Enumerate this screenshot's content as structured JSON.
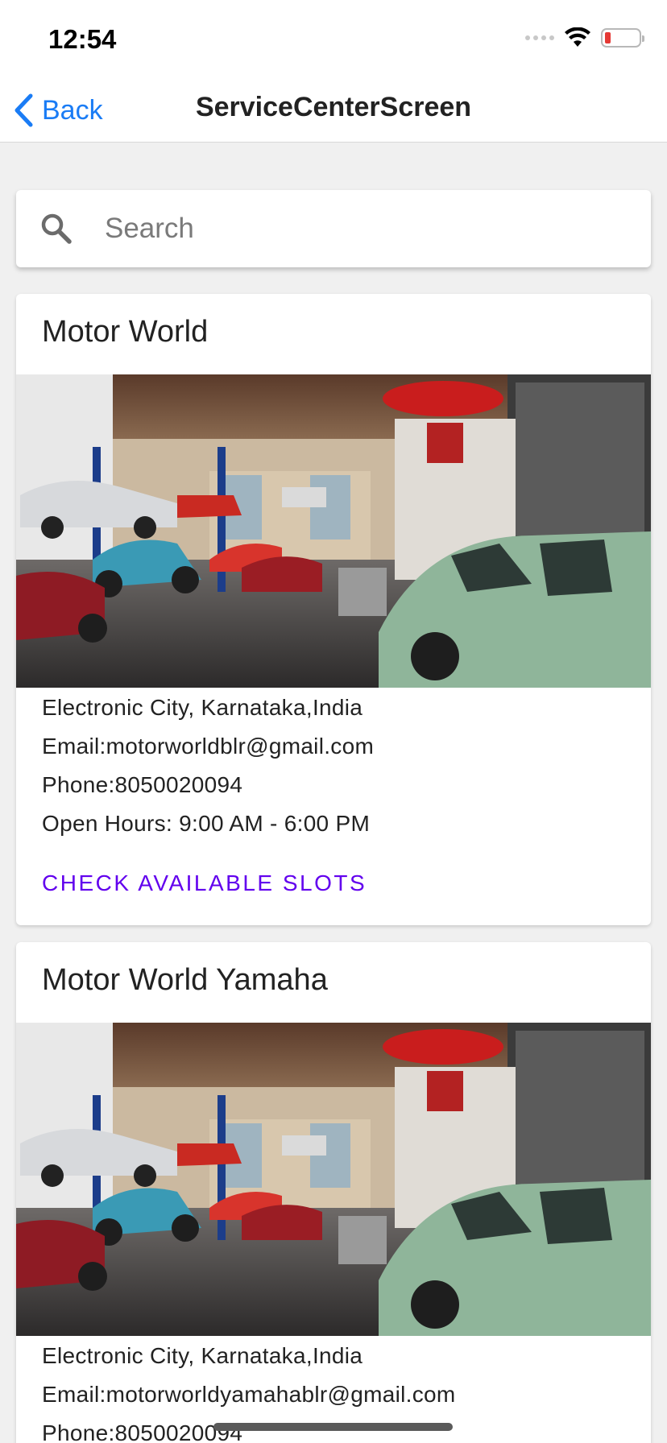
{
  "status": {
    "time": "12:54"
  },
  "nav": {
    "back_label": "Back",
    "title": "ServiceCenterScreen"
  },
  "search": {
    "placeholder": "Search",
    "value": ""
  },
  "colors": {
    "accent": "#1a7cf5",
    "primary": "#6200ee",
    "battery_low": "#e53935"
  },
  "cards": [
    {
      "title": "Motor World",
      "address": "Electronic City, Karnataka,India",
      "email": "Email:motorworldblr@gmail.com",
      "phone": "Phone:8050020094",
      "hours": "Open Hours: 9:00 AM - 6:00 PM",
      "action": "CHECK AVAILABLE SLOTS"
    },
    {
      "title": "Motor World Yamaha",
      "address": "Electronic City, Karnataka,India",
      "email": "Email:motorworldyamahablr@gmail.com",
      "phone": "Phone:8050020094"
    }
  ]
}
